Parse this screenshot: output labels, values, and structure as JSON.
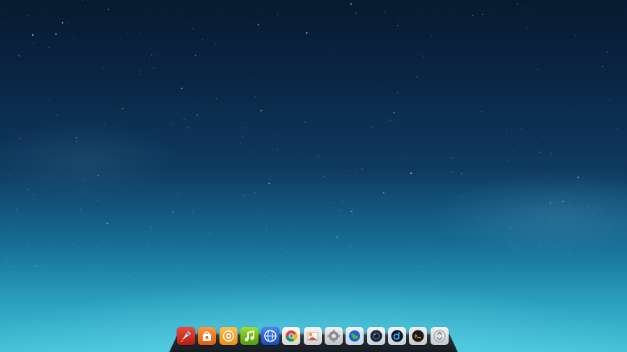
{
  "desktop": {
    "wallpaper": "starry-night-sky-gradient",
    "colors": {
      "sky_top": "#071a30",
      "sky_bottom": "#46c2d6",
      "dock_shelf": "#222b33"
    }
  },
  "dock": {
    "items": [
      {
        "icon": "rocket-launcher-icon",
        "color": "#d62a1c"
      },
      {
        "icon": "app-store-bag-icon",
        "color": "#f07a1a"
      },
      {
        "icon": "music-player-icon",
        "color": "#f5a623"
      },
      {
        "icon": "music-note-icon",
        "color": "#74c41c"
      },
      {
        "icon": "internet-globe-icon",
        "color": "#2a63d6"
      },
      {
        "icon": "chrome-browser-icon",
        "color": "#e8e8e8"
      },
      {
        "icon": "photo-viewer-icon",
        "color": "#e0e0e0"
      },
      {
        "icon": "system-settings-icon",
        "color": "#d8d8d8"
      },
      {
        "icon": "web-browser-globe-icon",
        "color": "#dfe6ee"
      },
      {
        "icon": "camera-lens-icon",
        "color": "#1e2a38"
      },
      {
        "icon": "deepin-logo-icon",
        "color": "#111a24"
      },
      {
        "icon": "terminal-icon",
        "color": "#1a1a1a"
      },
      {
        "icon": "trash-recycle-icon",
        "color": "#c8ccd0"
      }
    ]
  }
}
